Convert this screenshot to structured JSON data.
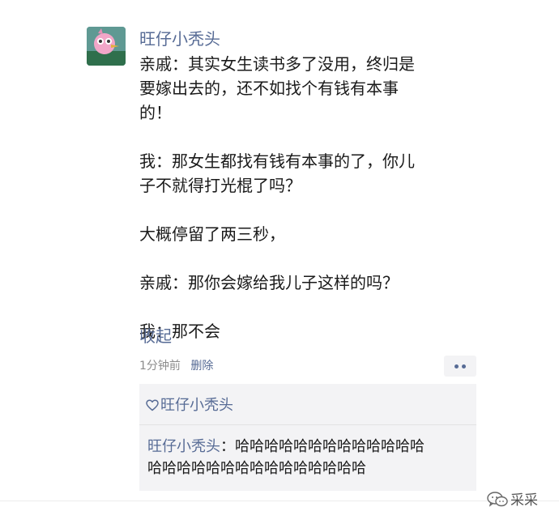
{
  "post": {
    "author": "旺仔小秃头",
    "avatar_icon": "pink-bird-avatar",
    "lines": [
      "亲戚：其实女生读书多了没用，终归是",
      "要嫁出去的，还不如找个有钱有本事",
      "的！",
      "",
      "我：那女生都找有钱有本事的了，你儿",
      "子不就得打光棍了吗？",
      "",
      "大概停留了两三秒，",
      "",
      "亲戚：那你会嫁给我儿子这样的吗？",
      "",
      "我：那不会"
    ],
    "collapse_label": "收起",
    "time": "1分钟前",
    "delete_label": "删除",
    "more_icon": "more-dots-icon"
  },
  "interactions": {
    "like_icon": "heart-outline-icon",
    "likes": "旺仔小秃头",
    "comment": {
      "author": "旺仔小秃头",
      "separator": "：",
      "text_line1": "哈哈哈哈哈哈哈哈哈哈哈哈哈",
      "text_line2": "哈哈哈哈哈哈哈哈哈哈哈哈哈哈哈"
    }
  },
  "watermark": {
    "icon": "wechat-bubble-icon",
    "text": "采采"
  },
  "colors": {
    "link": "#576b95",
    "text": "#1a1a1a",
    "meta": "#8c8c8c",
    "panel": "#f3f3f5"
  }
}
